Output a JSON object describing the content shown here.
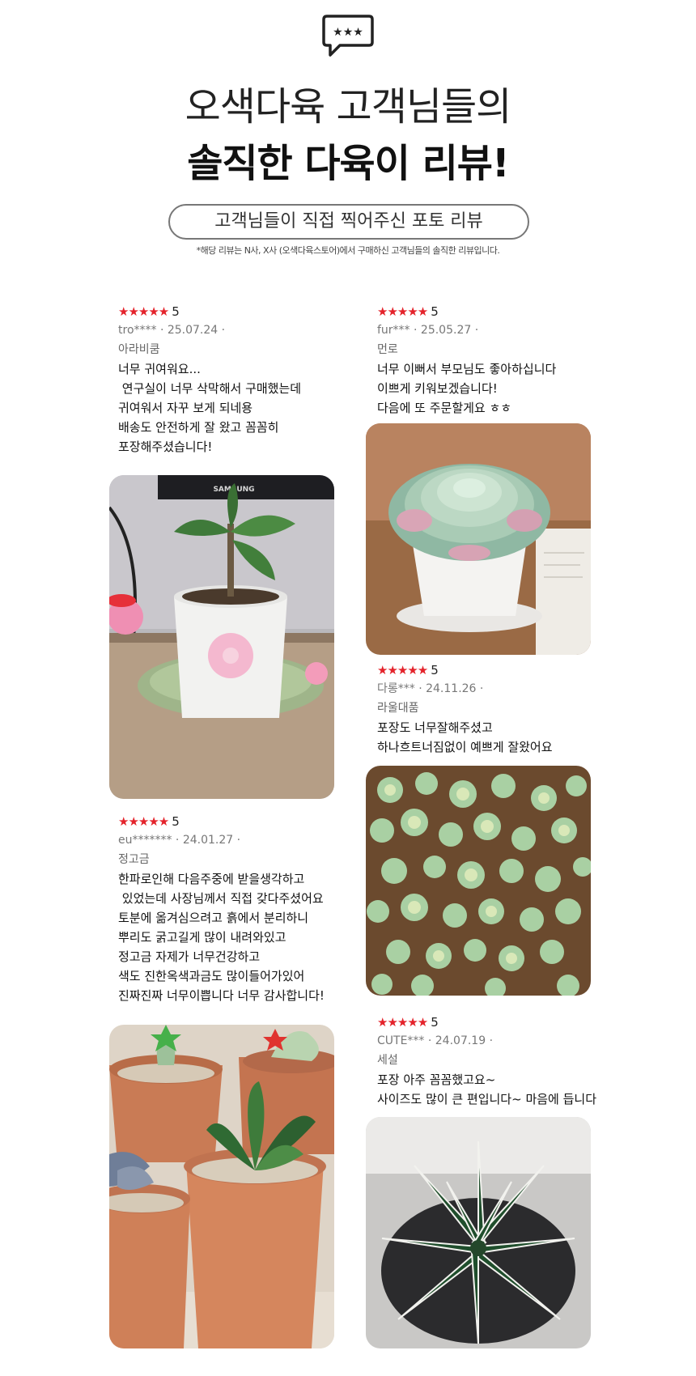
{
  "header": {
    "icon": "chat-bubble-stars-icon",
    "title_line1": "오색다육 고객님들의",
    "title_line2": "솔직한 다육이 리뷰!",
    "pill": "고객님들이 직접 찍어주신 포토 리뷰",
    "note": "*해당 리뷰는 N사, X사 (오색다육스토어)에서 구매하신 고객님들의 솔직한 리뷰입니다."
  },
  "colors": {
    "star": "#e4232b",
    "accent_text": "#111111",
    "meta": "#777777"
  },
  "reviews": [
    {
      "stars": "★★★★★",
      "score": "5",
      "meta": "tro**** · 25.07.24 ·",
      "option": "아라비쿰",
      "lines": [
        "너무 귀여워요...",
        " 연구실이 너무 삭막해서 구매했는데",
        "귀여워서 자꾸 보게 되네용",
        "배송도 안전하게 잘 왔고 꼼꼼히",
        "포장해주셨습니다!"
      ],
      "photo": "desk-plant-with-plush-photo",
      "photo_text": "SAMSUNG"
    },
    {
      "stars": "★★★★★",
      "score": "5",
      "meta": "fur*** · 25.05.27 ·",
      "option": "먼로",
      "lines": [
        "너무 이뻐서 부모님도 좋아하십니다",
        "이쁘게 키워보겠습니다!",
        "다음에 또 주문할게요 ㅎㅎ"
      ],
      "photo": "rosette-succulent-photo"
    },
    {
      "stars": "★★★★★",
      "score": "5",
      "meta": "다롱*** · 24.11.26 ·",
      "option": "라울대품",
      "lines": [
        "포장도 너무잘해주셨고",
        "하나흐트너짐없이 예쁘게 잘왔어요"
      ],
      "photo": "cluster-succulent-photo"
    },
    {
      "stars": "★★★★★",
      "score": "5",
      "meta": "eu******* · 24.01.27 ·",
      "option": "정고금",
      "lines": [
        "한파로인해 다음주중에 받을생각하고",
        " 있었는데 사장님께서 직접 갖다주셨어요",
        "토분에 옮겨심으려고 흙에서 분리하니",
        "뿌리도 굵고길게 많이 내려와있고",
        "정고금 자제가 너무건강하고",
        "색도 진한옥색과금도 많이들어가있어",
        "진짜진짜 너무이쁩니다 너무 감사합니다!"
      ],
      "photo": "terracotta-pots-photo"
    },
    {
      "stars": "★★★★★",
      "score": "5",
      "meta": "CUTE*** · 24.07.19 ·",
      "option": "세설",
      "lines": [
        "포장 아주 꼼꼼했고요~",
        "사이즈도 많이 큰 편입니다~ 마음에 듭니다"
      ],
      "photo": "agave-photo"
    }
  ]
}
